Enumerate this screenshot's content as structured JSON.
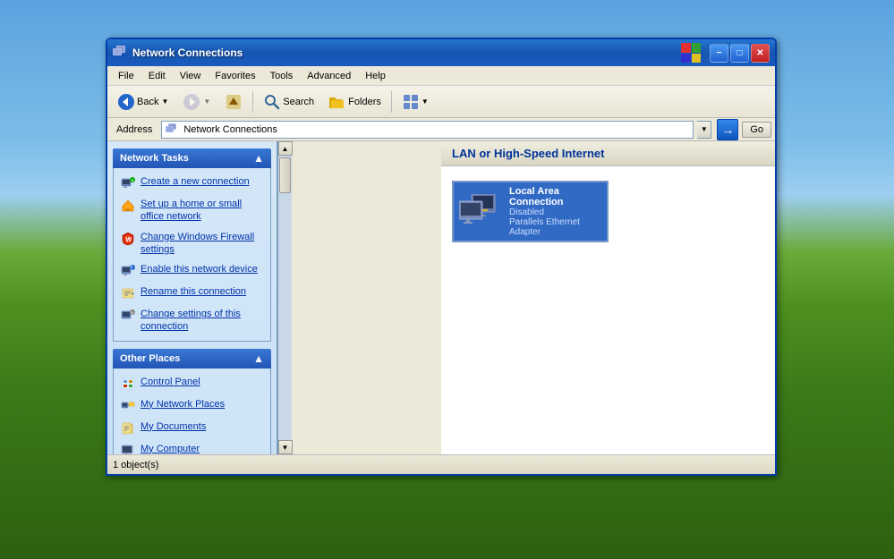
{
  "desktop": {
    "bg_top_color": "#5ba3e0",
    "bg_bottom_color": "#2d6010"
  },
  "window": {
    "title": "Network Connections",
    "title_icon": "network-connections-icon"
  },
  "menu": {
    "items": [
      "File",
      "Edit",
      "View",
      "Favorites",
      "Tools",
      "Advanced",
      "Help"
    ]
  },
  "toolbar": {
    "back_label": "Back",
    "forward_label": "",
    "up_label": "",
    "search_label": "Search",
    "folders_label": "Folders",
    "views_label": ""
  },
  "address_bar": {
    "label": "Address",
    "value": "Network Connections",
    "go_label": "Go"
  },
  "left_panel": {
    "network_tasks": {
      "header": "Network Tasks",
      "items": [
        {
          "icon": "new-connection-icon",
          "label": "Create a new connection"
        },
        {
          "icon": "home-network-icon",
          "label": "Set up a home or small office network"
        },
        {
          "icon": "firewall-icon",
          "label": "Change Windows Firewall settings"
        },
        {
          "icon": "enable-icon",
          "label": "Enable this network device"
        },
        {
          "icon": "rename-icon",
          "label": "Rename this connection"
        },
        {
          "icon": "settings-icon",
          "label": "Change settings of this connection"
        }
      ]
    },
    "other_places": {
      "header": "Other Places",
      "items": [
        {
          "icon": "control-panel-icon",
          "label": "Control Panel"
        },
        {
          "icon": "my-network-places-icon",
          "label": "My Network Places"
        },
        {
          "icon": "my-documents-icon",
          "label": "My Documents"
        },
        {
          "icon": "my-computer-icon",
          "label": "My Computer"
        }
      ]
    }
  },
  "main_content": {
    "section_title": "LAN or High-Speed Internet",
    "connections": [
      {
        "name": "Local Area Connection",
        "status": "Disabled",
        "adapter": "Parallels Ethernet Adapter"
      }
    ]
  },
  "title_buttons": {
    "minimize": "−",
    "maximize": "□",
    "close": "✕"
  }
}
